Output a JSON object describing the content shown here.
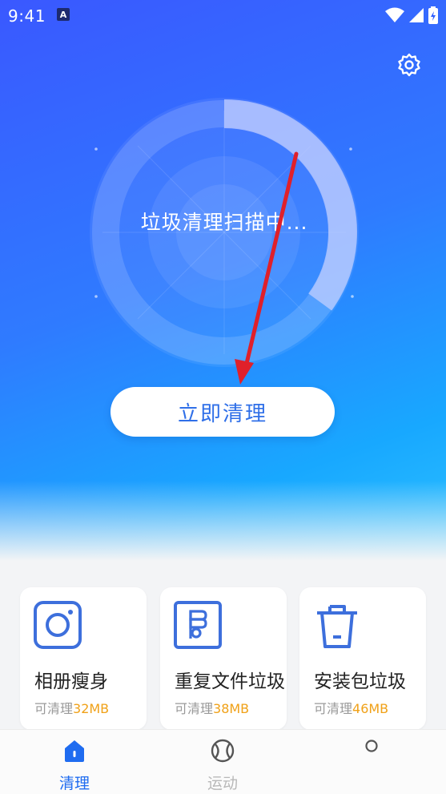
{
  "status_bar": {
    "time": "9:41",
    "notification": "A"
  },
  "scanner": {
    "status_text": "垃圾清理扫描中...",
    "progress_percent": 35
  },
  "clean_button": {
    "label": "立即清理"
  },
  "cards": [
    {
      "title": "相册瘦身",
      "sub_prefix": "可清理",
      "amount": "32MB",
      "icon": "camera-icon"
    },
    {
      "title": "重复文件垃圾",
      "sub_prefix": "可清理",
      "amount": "38MB",
      "icon": "duplicate-file-icon"
    },
    {
      "title": "安装包垃圾",
      "sub_prefix": "可清理",
      "amount": "46MB",
      "icon": "trash-icon"
    }
  ],
  "tabs": [
    {
      "label": "清理",
      "active": true,
      "icon": "home-icon"
    },
    {
      "label": "运动",
      "active": false,
      "icon": "ball-icon"
    },
    {
      "label": "",
      "active": false,
      "icon": "dot-icon"
    }
  ],
  "colors": {
    "primary": "#2f6fe8",
    "accent_amount": "#f0a118",
    "tab_inactive": "#b8b8b8",
    "annotation_arrow": "#e0202a"
  }
}
